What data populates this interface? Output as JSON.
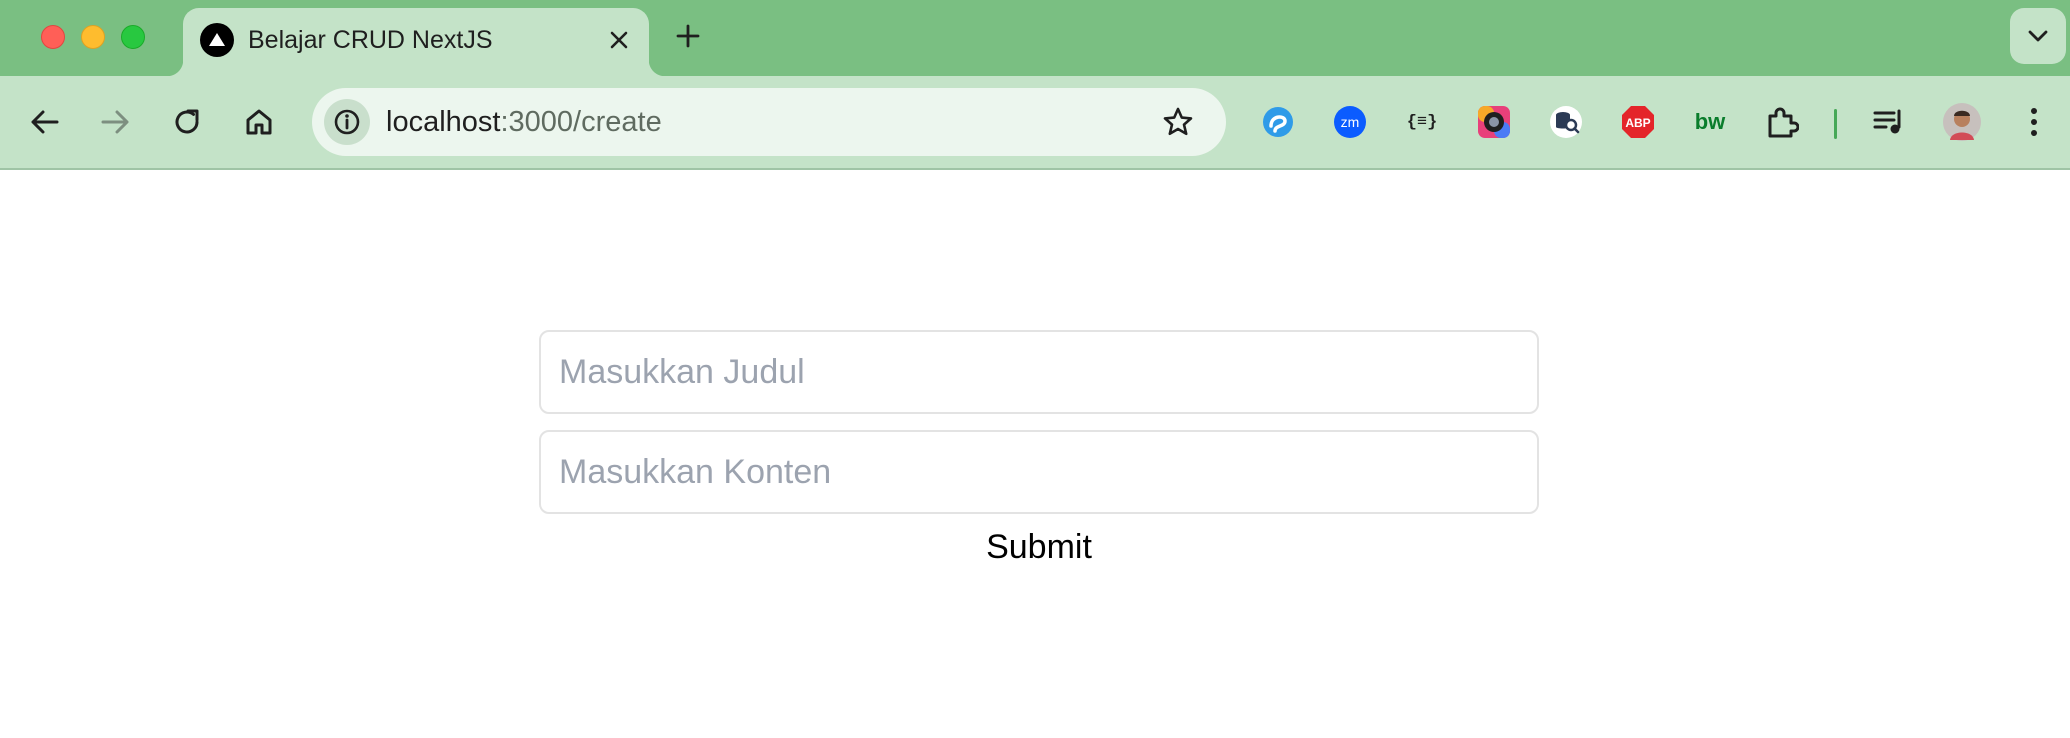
{
  "browser": {
    "tab": {
      "title": "Belajar CRUD NextJS"
    },
    "address": {
      "host": "localhost",
      "path": ":3000/create"
    }
  },
  "form": {
    "title_placeholder": "Masukkan Judul",
    "content_placeholder": "Masukkan Konten",
    "submit_label": "Submit"
  },
  "extensions": {
    "zoom_label": "zm",
    "json_label": "{≡}",
    "abp_label": "ABP",
    "bw_label": "bw"
  },
  "colors": {
    "frame": "#7abf82",
    "toolbar": "#c4e3c8",
    "omnibox": "#ecf6ee"
  }
}
